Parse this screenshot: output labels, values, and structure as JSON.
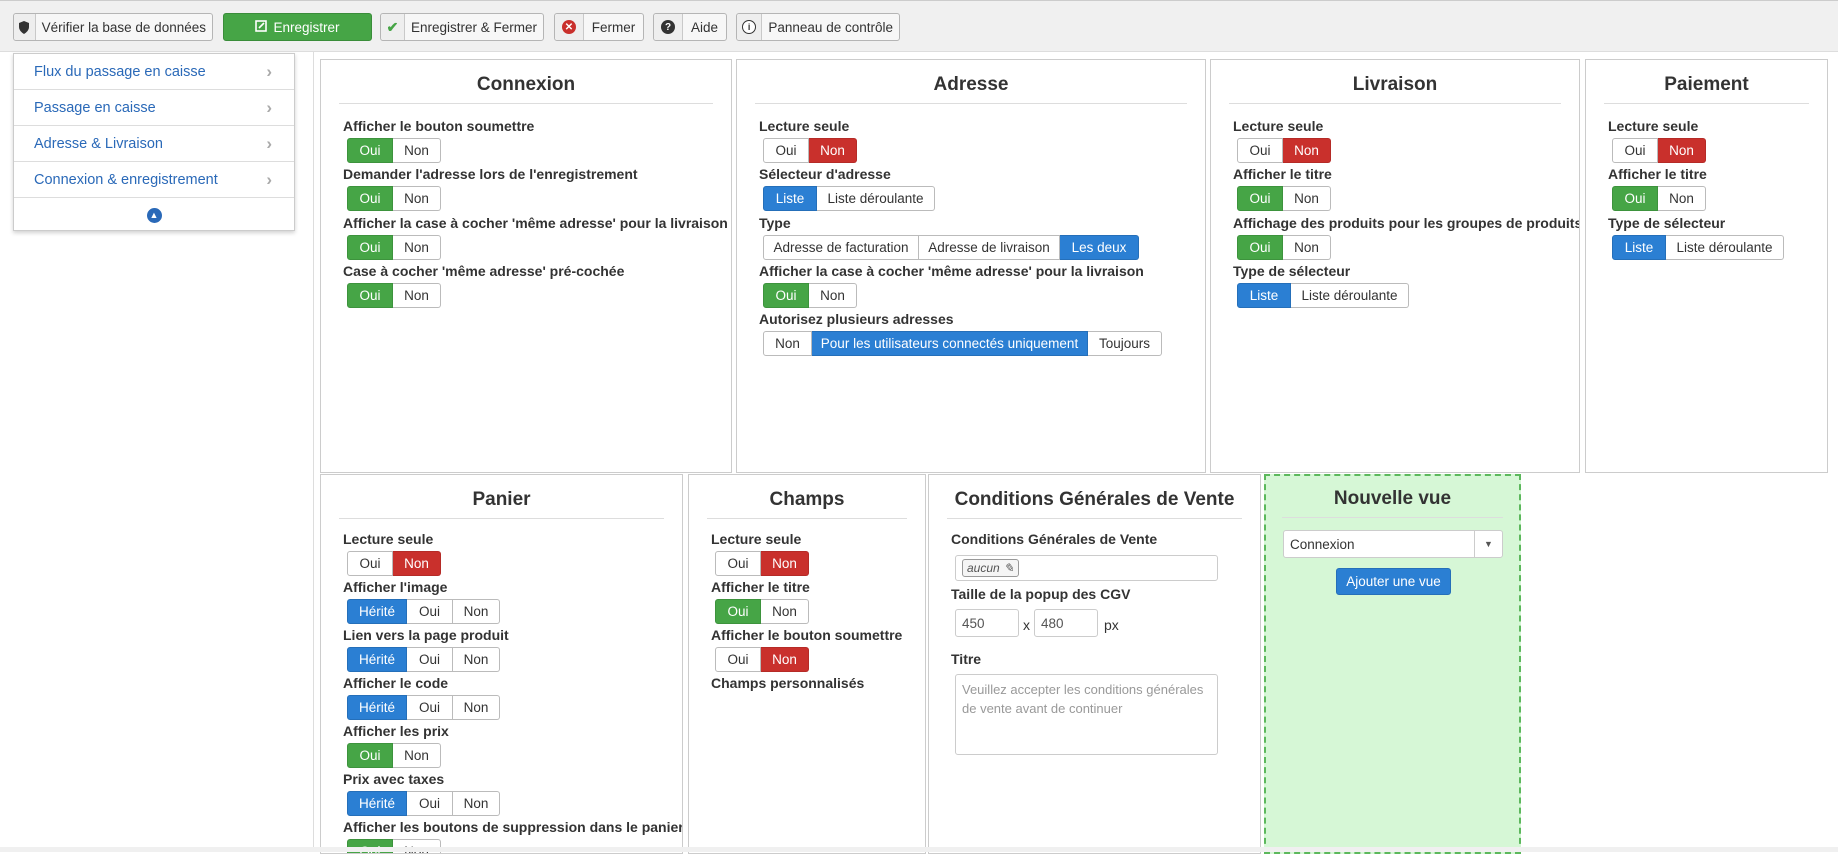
{
  "toolbar": {
    "check_db": "Vérifier la base de données",
    "save": "Enregistrer",
    "save_close": "Enregistrer & Fermer",
    "close": "Fermer",
    "help": "Aide",
    "control_panel": "Panneau de contrôle"
  },
  "sidebar": {
    "items": [
      {
        "label": "Flux du passage en caisse"
      },
      {
        "label": "Passage en caisse"
      },
      {
        "label": "Adresse & Livraison"
      },
      {
        "label": "Connexion & enregistrement"
      }
    ]
  },
  "common": {
    "oui": "Oui",
    "non": "Non",
    "herite": "Hérité",
    "liste": "Liste",
    "liste_deroulante": "Liste déroulante",
    "toujours": "Toujours"
  },
  "connexion": {
    "title": "Connexion",
    "f1": "Afficher le bouton soumettre",
    "f2": "Demander l'adresse lors de l'enregistrement",
    "f3": "Afficher la case à cocher 'même adresse' pour la livraison",
    "f4": "Case à cocher 'même adresse' pré-cochée"
  },
  "adresse": {
    "title": "Adresse",
    "f1": "Lecture seule",
    "f2": "Sélecteur d'adresse",
    "f3": "Type",
    "type_opts": [
      "Adresse de facturation",
      "Adresse de livraison",
      "Les deux"
    ],
    "f4": "Afficher la case à cocher 'même adresse' pour la livraison",
    "f5": "Autorisez plusieurs adresses",
    "multi_opts": [
      "Non",
      "Pour les utilisateurs connectés uniquement",
      "Toujours"
    ]
  },
  "livraison": {
    "title": "Livraison",
    "f1": "Lecture seule",
    "f2": "Afficher le titre",
    "f3": "Affichage des produits pour les groupes de produits",
    "f4": "Type de sélecteur"
  },
  "paiement": {
    "title": "Paiement",
    "f1": "Lecture seule",
    "f2": "Afficher le titre",
    "f3": "Type de sélecteur"
  },
  "panier": {
    "title": "Panier",
    "f1": "Lecture seule",
    "f2": "Afficher l'image",
    "f3": "Lien vers la page produit",
    "f4": "Afficher le code",
    "f5": "Afficher les prix",
    "f6": "Prix avec taxes",
    "f7": "Afficher les boutons de suppression dans le panier"
  },
  "champs": {
    "title": "Champs",
    "f1": "Lecture seule",
    "f2": "Afficher le titre",
    "f3": "Afficher le bouton soumettre",
    "f4": "Champs personnalisés"
  },
  "cgv": {
    "title": "Conditions Générales de Vente",
    "f1": "Conditions Générales de Vente",
    "tag": "aucun",
    "f2": "Taille de la popup des CGV",
    "width": "450",
    "height": "480",
    "x": "x",
    "px": "px",
    "f3": "Titre",
    "textarea": "Veuillez accepter les conditions générales de vente avant de continuer"
  },
  "nouvelle": {
    "title": "Nouvelle vue",
    "select_value": "Connexion",
    "add_button": "Ajouter une vue"
  },
  "colors": {
    "green": "#46a546",
    "red": "#c9302c",
    "blue": "#2b7fd3",
    "link": "#2a69b8",
    "new_view_bg": "#d6f7d6"
  }
}
